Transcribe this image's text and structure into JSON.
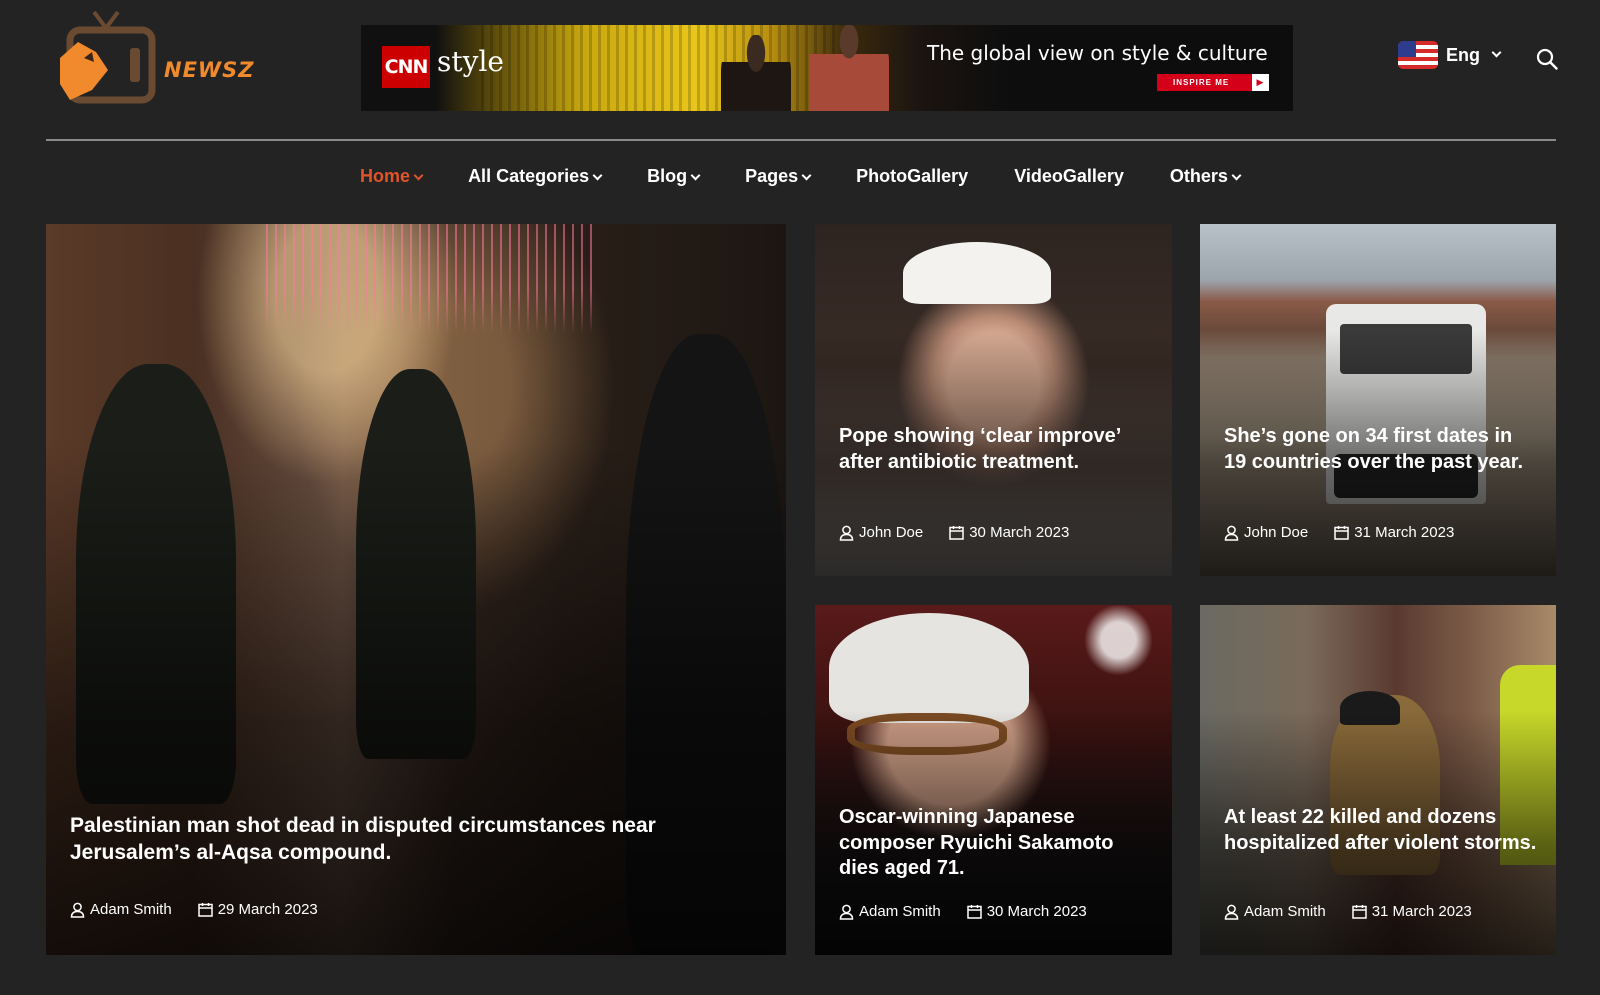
{
  "site": {
    "logo_text": "NEWSZ"
  },
  "ad": {
    "brand": "CNN",
    "brand_sub": "style",
    "tagline": "The global view on style & culture",
    "button": "INSPIRE ME"
  },
  "header": {
    "language": "Eng",
    "search_icon": "search-icon"
  },
  "nav": {
    "items": [
      {
        "label": "Home",
        "dropdown": true,
        "active": true
      },
      {
        "label": "All Categories",
        "dropdown": true
      },
      {
        "label": "Blog",
        "dropdown": true
      },
      {
        "label": "Pages",
        "dropdown": true
      },
      {
        "label": "PhotoGallery",
        "dropdown": false
      },
      {
        "label": "VideoGallery",
        "dropdown": false
      },
      {
        "label": "Others",
        "dropdown": true
      }
    ]
  },
  "articles": [
    {
      "title": "Palestinian man shot dead in disputed circumstances near Jerusalem’s al-Aqsa compound.",
      "author": "Adam Smith",
      "date": "29 March 2023"
    },
    {
      "title": "Pope showing ‘clear improve’ after antibiotic treatment.",
      "author": "John Doe",
      "date": "30 March 2023"
    },
    {
      "title": "She’s gone on 34 first dates in 19 countries over the past year.",
      "author": "John Doe",
      "date": "31 March 2023"
    },
    {
      "title": "Oscar-winning Japanese composer Ryuichi Sakamoto dies aged 71.",
      "author": "Adam Smith",
      "date": "30 March 2023"
    },
    {
      "title": "At least 22 killed and dozens hospitalized after violent storms.",
      "author": "Adam Smith",
      "date": "31 March 2023"
    }
  ],
  "colors": {
    "background": "#232323",
    "accent": "#e0542a",
    "logo": "#f08a2c"
  }
}
